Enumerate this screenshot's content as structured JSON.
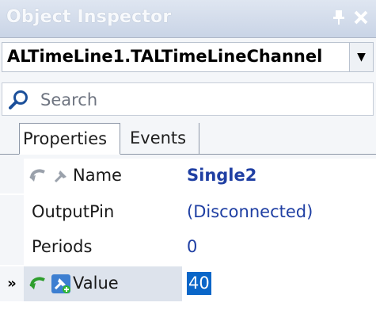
{
  "window": {
    "title": "Object Inspector"
  },
  "selector": {
    "value": "ALTimeLine1.TALTimeLineChannel"
  },
  "search": {
    "placeholder": "Search"
  },
  "tabs": [
    {
      "label": "Properties"
    },
    {
      "label": "Events"
    }
  ],
  "properties": [
    {
      "name": "Name",
      "value": "Single2",
      "value_color": "#1f3fa3",
      "value_bold": true
    },
    {
      "name": "OutputPin",
      "value": "(Disconnected)",
      "value_color": "#1f3fa3"
    },
    {
      "name": "Periods",
      "value": "0",
      "value_color": "#1f3fa3"
    },
    {
      "name": "Value",
      "value": "40",
      "marker": "»"
    }
  ],
  "colors": {
    "selection": "#0a66c8",
    "value_text": "#1f3fa3",
    "revert_active": "#2e9e2e"
  }
}
